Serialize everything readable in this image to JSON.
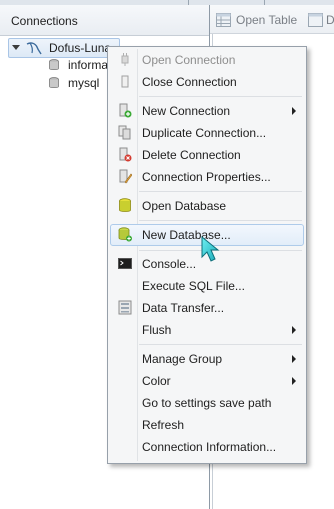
{
  "panel": {
    "title": "Connections",
    "connection": {
      "name": "Dofus-Luna"
    },
    "databases": [
      {
        "name": "informa"
      },
      {
        "name": "mysql"
      }
    ]
  },
  "toolbar": {
    "open_table_label": "Open Table",
    "cut_label": "D"
  },
  "menu": {
    "items": [
      {
        "label": "Open Connection",
        "icon": "plug-open-icon",
        "disabled": true
      },
      {
        "label": "Close Connection",
        "icon": "plug-close-icon"
      },
      {
        "label": "New Connection",
        "icon": "new-connection-icon",
        "submenu": true
      },
      {
        "label": "Duplicate Connection...",
        "icon": "duplicate-icon"
      },
      {
        "label": "Delete Connection",
        "icon": "delete-connection-icon"
      },
      {
        "label": "Connection Properties...",
        "icon": "properties-icon"
      },
      {
        "label": "Open Database",
        "icon": "database-icon"
      },
      {
        "label": "New Database...",
        "icon": "new-database-icon",
        "hovered": true
      },
      {
        "label": "Console...",
        "icon": "console-icon"
      },
      {
        "label": "Execute SQL File...",
        "icon": ""
      },
      {
        "label": "Data Transfer...",
        "icon": "data-transfer-icon"
      },
      {
        "label": "Flush",
        "icon": "",
        "submenu": true
      },
      {
        "label": "Manage Group",
        "icon": "",
        "submenu": true
      },
      {
        "label": "Color",
        "icon": "",
        "submenu": true
      },
      {
        "label": "Go to settings save path",
        "icon": ""
      },
      {
        "label": "Refresh",
        "icon": ""
      },
      {
        "label": "Connection Information...",
        "icon": ""
      }
    ]
  },
  "colors": {
    "menu_bg": "#f5f6f7",
    "hover_border": "#aecbea",
    "selection": "#dde9f6"
  }
}
